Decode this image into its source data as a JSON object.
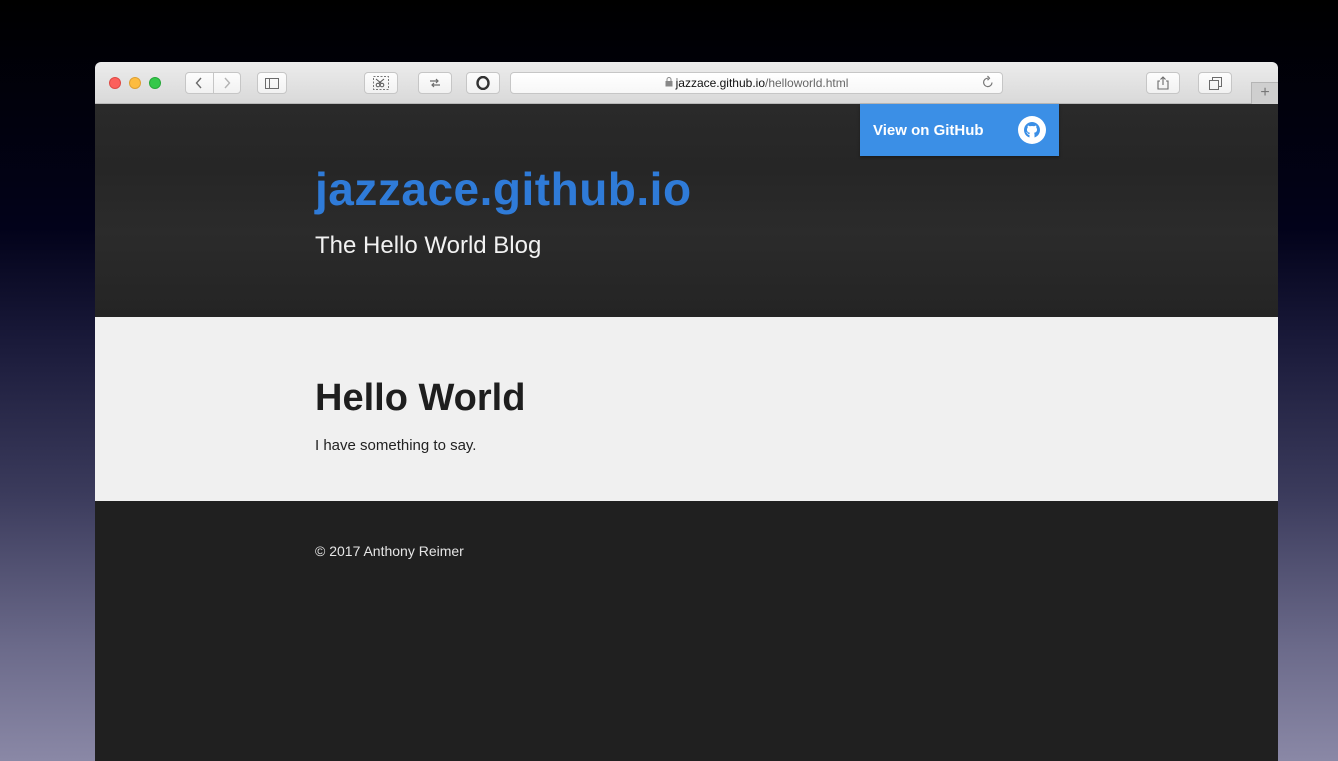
{
  "browser": {
    "nav": {
      "back_icon": "chevron-left-icon",
      "forward_icon": "chevron-right-icon"
    },
    "url": {
      "host": "jazzace.github.io",
      "path": "/helloworld.html"
    },
    "colors": {
      "close": "#fc605c",
      "minimize": "#fdbc40",
      "zoom": "#34c84a"
    }
  },
  "site": {
    "github_button": "View on GitHub",
    "title": "jazzace.github.io",
    "subtitle": "The Hello World Blog",
    "accent": "#2f7bd8",
    "button_color": "#3b8fe6"
  },
  "post": {
    "title": "Hello World",
    "body": "I have something to say."
  },
  "footer": {
    "copyright": "© 2017 Anthony Reimer"
  }
}
